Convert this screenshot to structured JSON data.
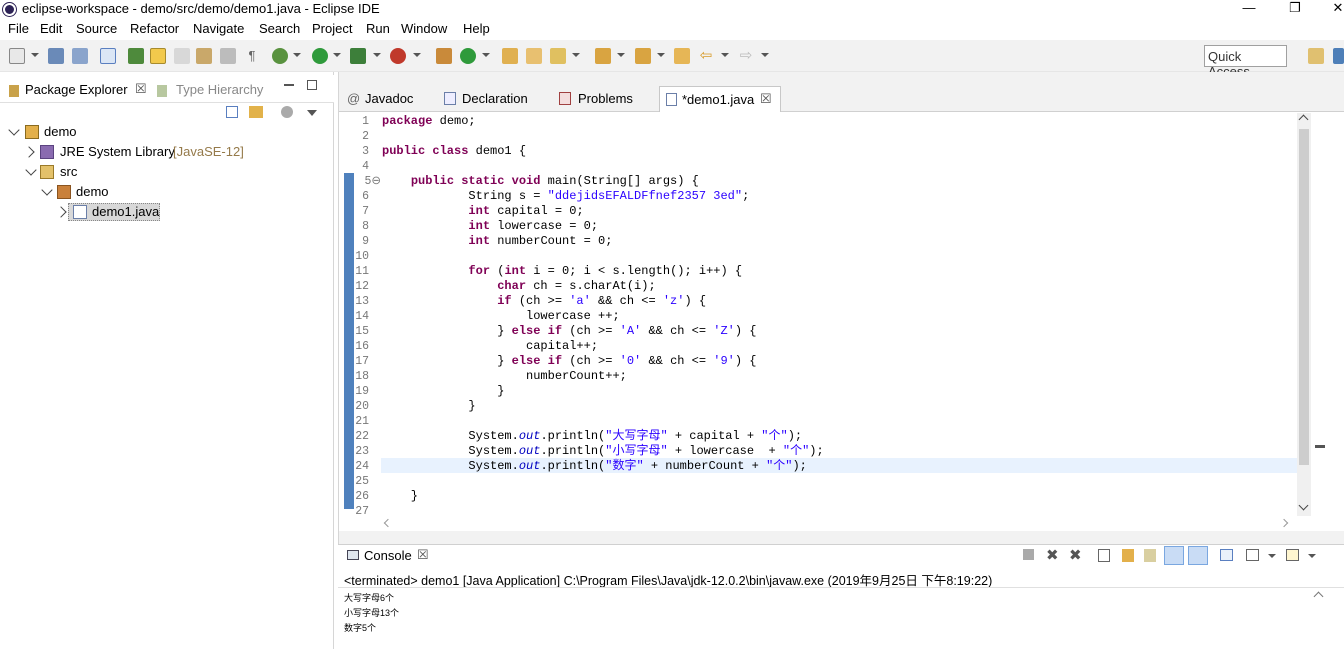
{
  "window": {
    "title": "eclipse-workspace - demo/src/demo/demo1.java - Eclipse IDE",
    "minimize": "—",
    "maximize": "❐",
    "close": "✕"
  },
  "menu": [
    "File",
    "Edit",
    "Source",
    "Refactor",
    "Navigate",
    "Search",
    "Project",
    "Run",
    "Window",
    "Help"
  ],
  "toolbar": {
    "quick_access": "Quick Access"
  },
  "left_panel": {
    "tabs": [
      {
        "label": "Package Explorer",
        "close": "☒"
      },
      {
        "label": "Type Hierarchy"
      }
    ],
    "tree": [
      {
        "label": "demo",
        "level": 0
      },
      {
        "label": "JRE System Library",
        "suffix": "[JavaSE-12]",
        "level": 1
      },
      {
        "label": "src",
        "level": 1
      },
      {
        "label": "demo",
        "level": 2
      },
      {
        "label": "demo1.java",
        "level": 3
      }
    ]
  },
  "editor": {
    "tabs": [
      {
        "label": "Javadoc",
        "icon": "@"
      },
      {
        "label": "Declaration"
      },
      {
        "label": "Problems"
      },
      {
        "label": "*demo1.java",
        "close": "☒"
      }
    ],
    "line_numbers": [
      "1",
      "2",
      "3",
      "4",
      "5⊖",
      "6",
      "7",
      "8",
      "9",
      "10",
      "11",
      "12",
      "13",
      "14",
      "15",
      "16",
      "17",
      "18",
      "19",
      "20",
      "21",
      "22",
      "23",
      "24",
      "25",
      "26",
      "27"
    ]
  },
  "console": {
    "tab_label": "Console",
    "close": "☒",
    "status": "<terminated> demo1 [Java Application] C:\\Program Files\\Java\\jdk-12.0.2\\bin\\javaw.exe (2019年9月25日 下午8:19:22)",
    "output": [
      "大写字母6个",
      "小写字母13个",
      "数字5个"
    ]
  }
}
